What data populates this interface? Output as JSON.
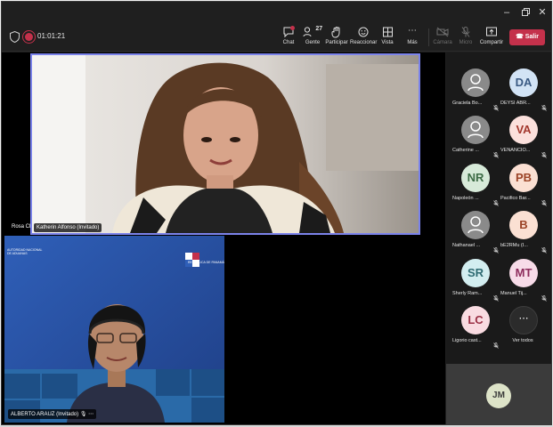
{
  "toolbar": {
    "timer": "01:01:21",
    "chat_label": "Chat",
    "people_label": "Gente",
    "people_count": "27",
    "raise_label": "Participar",
    "react_label": "Reaccionar",
    "view_label": "Vista",
    "more_label": "Más",
    "camera_label": "Cámara",
    "mic_label": "Micro",
    "share_label": "Compartir",
    "leave_label": "Salir"
  },
  "stage": {
    "side_label": "Rosa Ch",
    "main_name": "Katherin Alfonso (Invitado)",
    "second_name": "ALBERTO ARAUZ (Invitado)",
    "second_bg_text_left": "AUTORIDAD NACIONAL DE ADUANAS",
    "second_bg_text_right": "REPÚBLICA DE PANAMÁ"
  },
  "roster": [
    {
      "name": "Graciela Bo...",
      "initials": "",
      "bg": "#8a8a8a",
      "fg": "#ffffff"
    },
    {
      "name": "DEYSI ABR...",
      "initials": "DA",
      "bg": "#d2e3f5",
      "fg": "#3b5a83"
    },
    {
      "name": "Catherine ...",
      "initials": "",
      "bg": "#8a8a8a",
      "fg": "#ffffff"
    },
    {
      "name": "VENANCIO...",
      "initials": "VA",
      "bg": "#fbe0dc",
      "fg": "#a3382e"
    },
    {
      "name": "Napoleón ...",
      "initials": "NR",
      "bg": "#d7ead9",
      "fg": "#3c6b45"
    },
    {
      "name": "Pacifico Bar...",
      "initials": "PB",
      "bg": "#fbe0d3",
      "fg": "#9b4326"
    },
    {
      "name": "Nathanael ...",
      "initials": "",
      "bg": "#8a8a8a",
      "fg": "#ffffff"
    },
    {
      "name": "bE2RMu (I...",
      "initials": "B",
      "bg": "#fbe0d3",
      "fg": "#9b4326"
    },
    {
      "name": "Sherly Ram...",
      "initials": "SR",
      "bg": "#d3eef0",
      "fg": "#2e6b72"
    },
    {
      "name": "Manuel Tij...",
      "initials": "MT",
      "bg": "#f7dbe8",
      "fg": "#8d2c5d"
    },
    {
      "name": "Ligorio cast...",
      "initials": "LC",
      "bg": "#f9dbe1",
      "fg": "#9a2f44"
    }
  ],
  "roster_more_label": "Ver todos",
  "self_initials": "JM"
}
